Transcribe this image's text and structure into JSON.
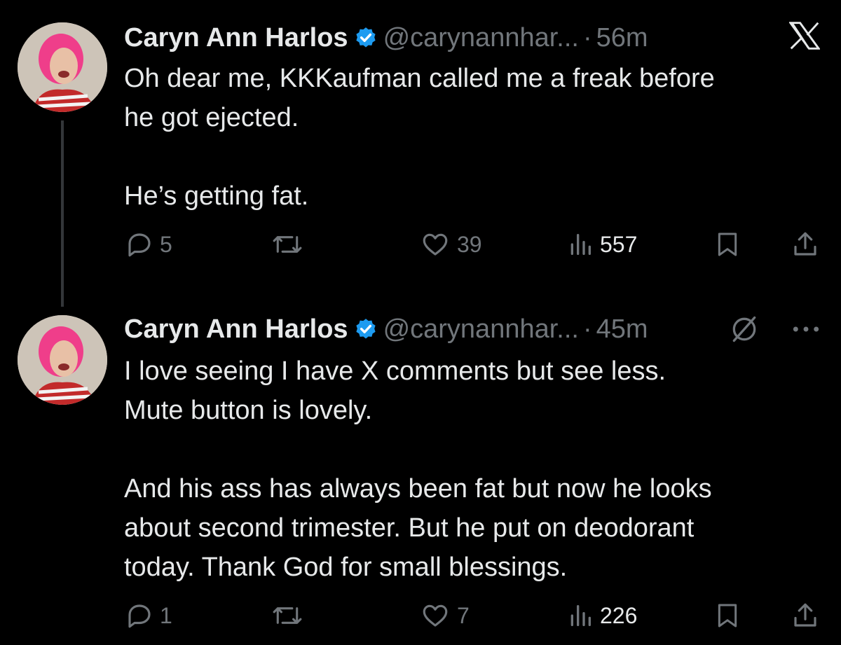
{
  "tweets": [
    {
      "author_name": "Caryn Ann Harlos",
      "handle": "@carynannhar...",
      "separator": "·",
      "time": "56m",
      "lines": [
        "Oh dear me, KKKaufman called me a freak before",
        "he got ejected."
      ],
      "para2": [
        "He’s getting fat."
      ],
      "replies": "5",
      "reposts": "",
      "likes": "39",
      "views": "557"
    },
    {
      "author_name": "Caryn Ann Harlos",
      "handle": "@carynannhar...",
      "separator": "·",
      "time": "45m",
      "lines": [
        "I love seeing I have X comments but see less.",
        "Mute button is lovely."
      ],
      "para2": [
        "And his ass has always been fat but now he looks",
        "about second trimester.  But he put on deodorant",
        "today.  Thank God for small blessings."
      ],
      "replies": "1",
      "reposts": "",
      "likes": "7",
      "views": "226"
    }
  ],
  "colors": {
    "background": "#000000",
    "text": "#e7e9ea",
    "muted": "#71767b",
    "verified": "#1d9bf0",
    "thread_line": "#333639"
  },
  "icons": [
    "x-logo-icon",
    "verified-badge-icon",
    "reply-icon",
    "repost-icon",
    "like-icon",
    "views-icon",
    "bookmark-icon",
    "share-icon",
    "grok-icon",
    "more-icon"
  ]
}
